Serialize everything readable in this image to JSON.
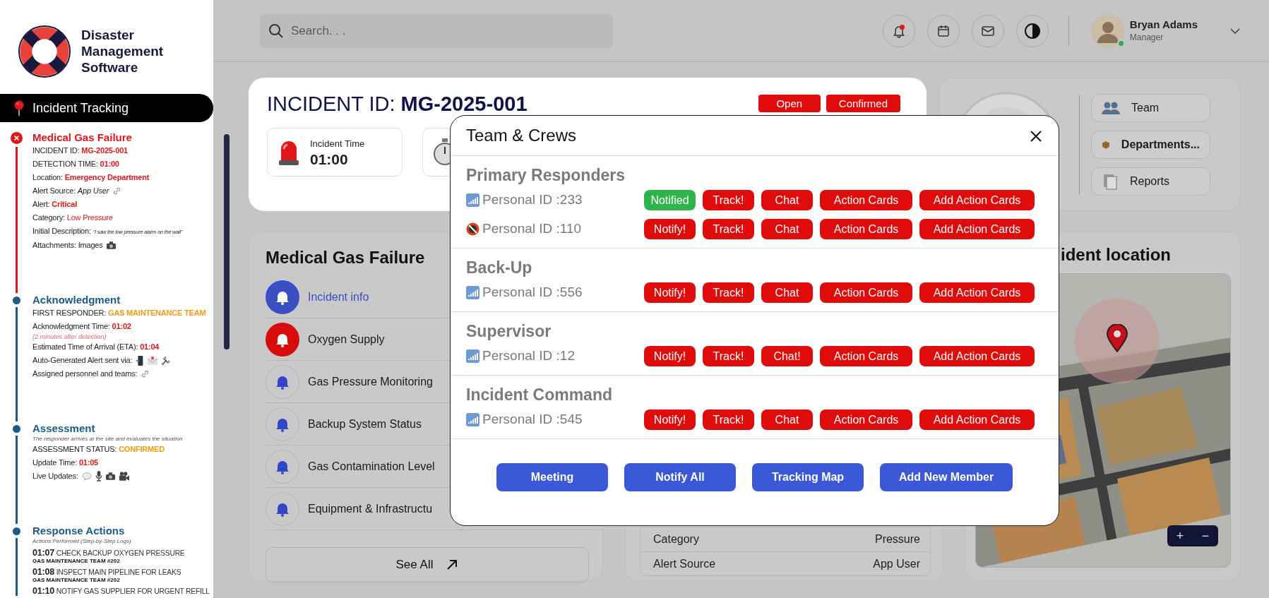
{
  "sidebar": {
    "app_name": "Disaster Management Software",
    "active_nav": "Incident Tracking",
    "timeline": [
      {
        "kind": "alert",
        "color": "#e0161b",
        "title": "Medical Gas Failure",
        "lines": [
          {
            "label": "INCIDENT ID:",
            "value": "MG-2025-001",
            "kind": "critical"
          },
          {
            "label": "DETECTION TIME:",
            "value": "01:00",
            "kind": "critical"
          },
          {
            "label": "Location:",
            "value": "Emergency Department",
            "kind": "critical"
          },
          {
            "label": "Alert Source:",
            "value": "App User",
            "kind": "source"
          },
          {
            "label": "Alert:",
            "value": "Critical",
            "kind": "critical"
          },
          {
            "label": "Category:",
            "value": "Low Pressure",
            "kind": "soft"
          },
          {
            "label": "Initial Description:",
            "value": "\"I saw the low pressure alarm on the wall\"",
            "kind": "quote"
          },
          {
            "label": "Attachments: Images",
            "kind": "attachment"
          }
        ]
      },
      {
        "kind": "step",
        "color": "#1d5a88",
        "title": "Acknowledgment",
        "lines": [
          {
            "label": "FIRST RESPONDER:",
            "value": "GAS MAINTENANCE TEAM",
            "kind": "status"
          },
          {
            "label": "Acknowledgment Time:",
            "value": "01:02",
            "kind": "critical"
          },
          {
            "label": "(2 minutes after detection)",
            "kind": "note"
          },
          {
            "label": "Estimated Time of Arrival (ETA):",
            "value": "01:04",
            "kind": "critical"
          },
          {
            "label": "Auto-Generated Alert sent via:",
            "kind": "channels"
          },
          {
            "label": "Assigned personnel and teams:",
            "kind": "link"
          }
        ]
      },
      {
        "kind": "step",
        "color": "#1d5a88",
        "title": "Assessment",
        "subtitle": "The responder arrives at the site and evaluates the situation",
        "lines": [
          {
            "label": "ASSESSMENT STATUS:",
            "value": "CONFIRMED",
            "kind": "status"
          },
          {
            "label": "Update Time:",
            "value": "01:05",
            "kind": "critical"
          },
          {
            "label": "Live Updates:",
            "kind": "media"
          }
        ]
      },
      {
        "kind": "step",
        "color": "#1d5a88",
        "title": "Response Actions",
        "subtitle": "Actions Performed (Step-by-Step Logs)",
        "logs": [
          {
            "time": "01:07",
            "action": "CHECK BACKUP OXYGEN PRESSURE",
            "team": "GAS MAINTENANCE TEAM #202"
          },
          {
            "time": "01:08",
            "action": "INSPECT MAIN PIPELINE FOR LEAKS",
            "team": "GAS MAINTENANCE TEAM #202"
          },
          {
            "time": "01:10",
            "action": "NOTIFY GAS SUPPLIER FOR URGENT REFILL"
          }
        ]
      }
    ]
  },
  "header": {
    "search": {
      "placeholder": "Search. . ."
    },
    "notifications_unread": true,
    "user": {
      "name": "Bryan Adams",
      "role": "Manager",
      "online": true
    }
  },
  "incident": {
    "title": "INCIDENT ID: **MG-2025-001**",
    "badges": [
      "Open",
      "Confirmed"
    ],
    "stats": [
      {
        "kind": "siren",
        "label": "Incident Time",
        "value": "01:00"
      },
      {
        "kind": "timer"
      }
    ]
  },
  "quick_nav": [
    {
      "label": "Team",
      "selected": false
    },
    {
      "label": "Departments...",
      "selected": true
    },
    {
      "label": "Reports",
      "selected": false
    }
  ],
  "incident_panel": {
    "title": "Medical Gas Failure",
    "items": [
      {
        "label": "Incident info",
        "selected": true,
        "alarm": false
      },
      {
        "label": "Oxygen Supply",
        "selected": false,
        "alarm": true
      },
      {
        "label": "Gas Pressure Monitoring",
        "selected": false,
        "alarm": false
      },
      {
        "label": "Backup System Status",
        "selected": false,
        "alarm": false
      },
      {
        "label": "Gas Contamination Level",
        "selected": false,
        "alarm": false
      },
      {
        "label": "Equipment & Infrastructu",
        "selected": false,
        "alarm": false
      }
    ],
    "see_all": "See All"
  },
  "details_table": [
    {
      "label": "Category",
      "value": "Pressure"
    },
    {
      "label": "Alert Source",
      "value": "App User"
    }
  ],
  "location_panel": {
    "title": "ident location",
    "zoom_in": "+",
    "zoom_out": "−"
  },
  "modal": {
    "title": "Team & Crews",
    "groups": [
      {
        "title": "Primary Responders",
        "members": [
          {
            "id": "Personal ID :233",
            "connected": true,
            "actions": [
              {
                "label": "Notified",
                "done": true
              },
              {
                "label": "Track!",
                "done": false
              },
              {
                "label": "Chat",
                "done": false
              },
              {
                "label": "Action Cards",
                "done": false
              },
              {
                "label": "Add Action Cards",
                "done": false
              }
            ]
          },
          {
            "id": "Personal ID :110",
            "connected": false,
            "actions": [
              {
                "label": "Notify!",
                "done": false
              },
              {
                "label": "Track!",
                "done": false
              },
              {
                "label": "Chat",
                "done": false
              },
              {
                "label": "Action Cards",
                "done": false
              },
              {
                "label": "Add Action Cards",
                "done": false
              }
            ]
          }
        ]
      },
      {
        "title": "Back-Up",
        "members": [
          {
            "id": "Personal ID :556",
            "connected": true,
            "actions": [
              {
                "label": "Notify!",
                "done": false
              },
              {
                "label": "Track!",
                "done": false
              },
              {
                "label": "Chat",
                "done": false
              },
              {
                "label": "Action Cards",
                "done": false
              },
              {
                "label": "Add Action Cards",
                "done": false
              }
            ]
          }
        ]
      },
      {
        "title": "Supervisor",
        "members": [
          {
            "id": "Personal ID :12",
            "connected": true,
            "actions": [
              {
                "label": "Notify!",
                "done": false
              },
              {
                "label": "Track!",
                "done": false
              },
              {
                "label": "Chat!",
                "done": false
              },
              {
                "label": "Action Cards",
                "done": false
              },
              {
                "label": "Add Action Cards",
                "done": false
              }
            ]
          }
        ]
      },
      {
        "title": "Incident Command",
        "members": [
          {
            "id": "Personal ID :545",
            "connected": true,
            "actions": [
              {
                "label": "Notify!",
                "done": false
              },
              {
                "label": "Track!",
                "done": false
              },
              {
                "label": "Chat",
                "done": false
              },
              {
                "label": "Action Cards",
                "done": false
              },
              {
                "label": "Add Action Cards",
                "done": false
              }
            ]
          }
        ]
      }
    ],
    "footer_buttons": [
      "Meeting",
      "Notify All",
      "Tracking Map",
      "Add New Member"
    ]
  }
}
